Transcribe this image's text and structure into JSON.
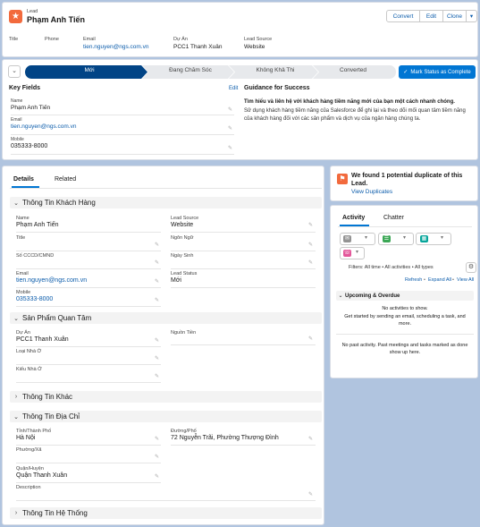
{
  "header": {
    "object_type": "Lead",
    "record_name": "Phạm Anh Tiến",
    "buttons": [
      "Convert",
      "Edit",
      "Clone"
    ],
    "highlights": [
      {
        "label": "Title",
        "value": ""
      },
      {
        "label": "Phone",
        "value": ""
      },
      {
        "label": "Email",
        "value": "tien.nguyen@ngs.com.vn"
      },
      {
        "label": "Dự Án",
        "value": "PCC1 Thanh Xuân"
      },
      {
        "label": "Lead Source",
        "value": "Website"
      }
    ]
  },
  "path": {
    "stages": [
      "Mới",
      "Đang Chăm Sóc",
      "Không Khả Thi",
      "Converted"
    ],
    "mark_button": "Mark Status as Complete"
  },
  "key_fields": {
    "title": "Key Fields",
    "edit": "Edit",
    "fields": [
      {
        "label": "Name",
        "value": "Phạm Anh Tiến"
      },
      {
        "label": "Email",
        "value": "tien.nguyen@ngs.com.vn"
      },
      {
        "label": "Mobile",
        "value": "035333-8000"
      }
    ]
  },
  "guidance": {
    "title": "Guidance for Success",
    "bold": "Tìm hiểu và liên hệ với khách hàng tiềm năng mới của bạn một cách nhanh chóng.",
    "text": "Sử dụng khách hàng tiềm năng của Salesforce để ghi lại và theo dõi mối quan tâm tiềm năng của khách hàng đối với các sản phẩm và dịch vụ của ngân hàng chúng ta."
  },
  "tabs": {
    "details": "Details",
    "related": "Related"
  },
  "sections": {
    "khach_hang": "Thông Tin Khách Hàng",
    "san_pham": "Sản Phẩm Quan Tâm",
    "khac": "Thông Tin Khác",
    "dia_chi": "Thông Tin Địa Chỉ",
    "he_thong": "Thông Tin Hệ Thống"
  },
  "kh_fields": {
    "name": {
      "label": "Name",
      "value": "Phạm Anh Tiến"
    },
    "lead_source": {
      "label": "Lead Source",
      "value": "Website"
    },
    "title": {
      "label": "Title",
      "value": ""
    },
    "ngon_ngu": {
      "label": "Ngôn Ngữ",
      "value": ""
    },
    "cccd": {
      "label": "Số CCCD/CMND",
      "value": ""
    },
    "ngay_sinh": {
      "label": "Ngày Sinh",
      "value": ""
    },
    "email": {
      "label": "Email",
      "value": "tien.nguyen@ngs.com.vn"
    },
    "lead_status": {
      "label": "Lead Status",
      "value": "Mới"
    },
    "mobile": {
      "label": "Mobile",
      "value": "035333-8000"
    }
  },
  "sp_fields": {
    "du_an": {
      "label": "Dự Án",
      "value": "PCC1 Thanh Xuân"
    },
    "nguon_tien": {
      "label": "Nguồn Tiền",
      "value": ""
    },
    "loai_nha": {
      "label": "Loại Nhà Ở",
      "value": ""
    },
    "kieu_nha": {
      "label": "Kiểu Nhà Ở",
      "value": ""
    }
  },
  "dc_fields": {
    "tinh": {
      "label": "Tỉnh/Thành Phố",
      "value": "Hà Nội"
    },
    "duong": {
      "label": "Đường/Phố",
      "value": "72 Nguyễn Trãi, Phường Thượng Đình"
    },
    "phuong": {
      "label": "Phường/Xã",
      "value": ""
    },
    "quan": {
      "label": "Quận/Huyện",
      "value": "Quận Thanh Xuân"
    },
    "description": {
      "label": "Description",
      "value": ""
    }
  },
  "duplicate": {
    "title": "We found 1 potential duplicate of this Lead.",
    "link": "View Duplicates"
  },
  "activity": {
    "tabs": [
      "Activity",
      "Chatter"
    ],
    "filters": "Filters: All time • All activities • All types",
    "links": [
      "Refresh",
      "Expand All",
      "View All"
    ],
    "upcoming_title": "Upcoming & Overdue",
    "no_activities": "No activities to show.",
    "get_started": "Get started by sending an email, scheduling a task, and more.",
    "no_past": "No past activity. Past meetings and tasks marked as done show up here."
  },
  "colors": {
    "brand": "#0176d3",
    "path_dark": "#014486",
    "lead_icon": "#f26a3d",
    "background": "#b0c4df"
  }
}
